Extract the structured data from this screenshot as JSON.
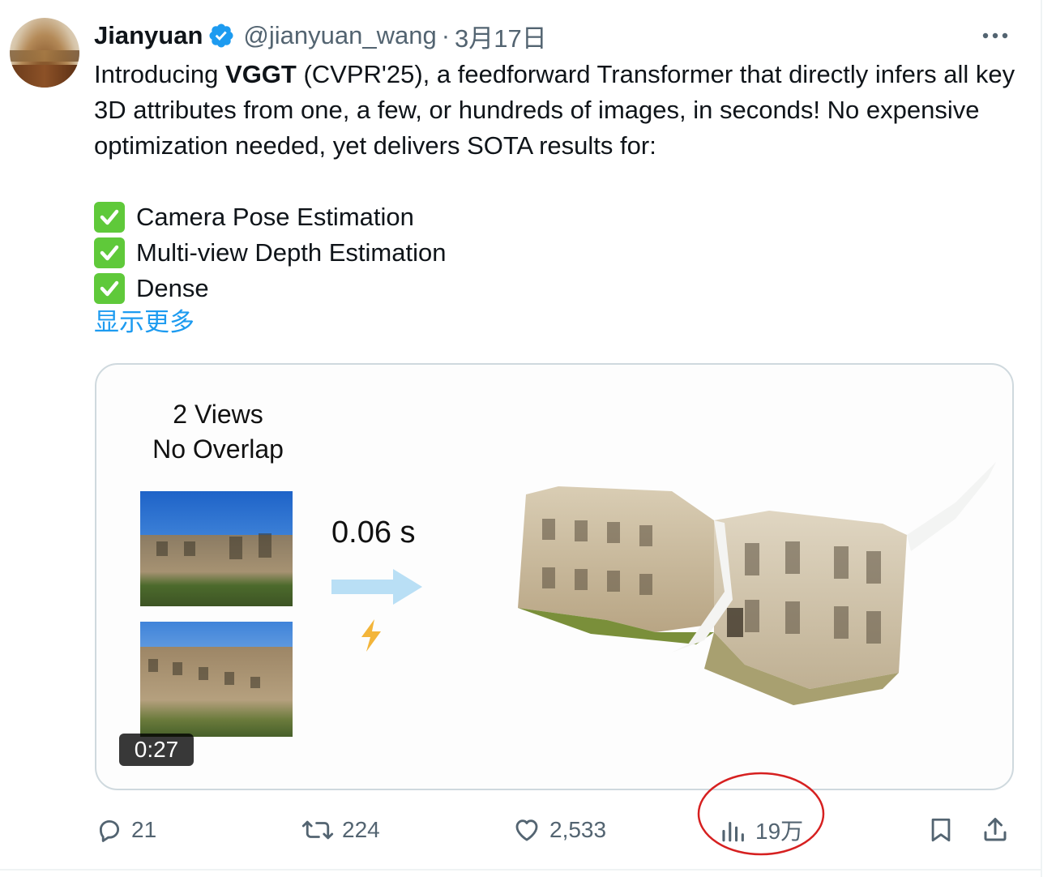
{
  "author": {
    "name": "Jianyuan",
    "handle": "@jianyuan_wang",
    "separator": "·",
    "date": "3月17日"
  },
  "tweet": {
    "intro": "Introducing",
    "product": "VGGT",
    "body": " (CVPR'25), a feedforward Transformer that directly infers all key 3D attributes from one, a few, or hundreds of images, in seconds! No expensive optimization needed, yet delivers SOTA results for:",
    "bullets": [
      "Camera Pose Estimation",
      "Multi-view Depth Estimation",
      "Dense"
    ],
    "show_more": "显示更多"
  },
  "media": {
    "views_line1": "2 Views",
    "views_line2": "No Overlap",
    "speed": "0.06 s",
    "duration": "0:27"
  },
  "actions": {
    "replies": "21",
    "reposts": "224",
    "likes": "2,533",
    "views": "19万"
  },
  "colors": {
    "link": "#1d9bf0",
    "secondary_text": "#536471",
    "verified": "#1d9bf0",
    "check": "#5fc93a",
    "annotation_circle": "#d62020"
  },
  "icons": [
    "verified-badge-icon",
    "more-icon",
    "check-icon",
    "reply-icon",
    "repost-icon",
    "like-icon",
    "views-icon",
    "bookmark-icon",
    "share-icon"
  ]
}
